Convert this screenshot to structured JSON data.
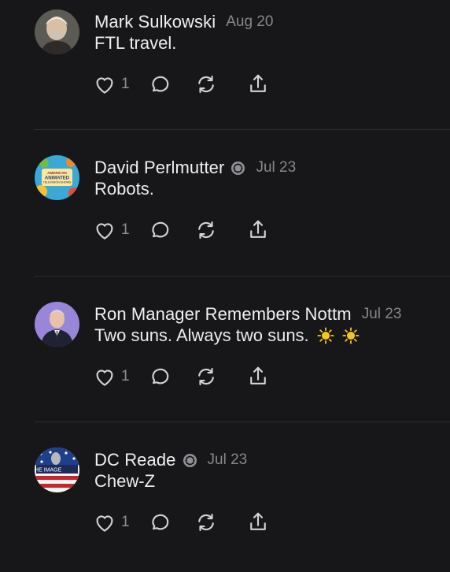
{
  "comments": [
    {
      "author": "Mark Sulkowski",
      "verified": false,
      "date": "Aug 20",
      "text": "FTL travel.",
      "likes": "1",
      "avatar": "photo-portrait"
    },
    {
      "author": "David Perlmutter",
      "verified": true,
      "date": "Jul 23",
      "text": "Robots.",
      "likes": "1",
      "avatar": "animated-shows-book-cover",
      "avatar_text": "AMERICAN ANIMATED TELEVISION SHOWS"
    },
    {
      "author": "Ron Manager Remembers Nottm",
      "verified": false,
      "date": "Jul 23",
      "text": "Two suns. Always two suns.",
      "likes": "1",
      "avatar": "man-in-suit-purple",
      "emoji": [
        "sun-icon",
        "sun-icon"
      ]
    },
    {
      "author": "DC Reade",
      "verified": true,
      "date": "Jul 23",
      "text": "Chew-Z",
      "likes": "1",
      "avatar": "flag-the-image",
      "avatar_text": "THE IMAGE"
    }
  ],
  "colors": {
    "background": "#17171a",
    "text": "#ececee",
    "muted": "#86868c",
    "divider": "#2d2d31",
    "sun": "#f5c518"
  }
}
